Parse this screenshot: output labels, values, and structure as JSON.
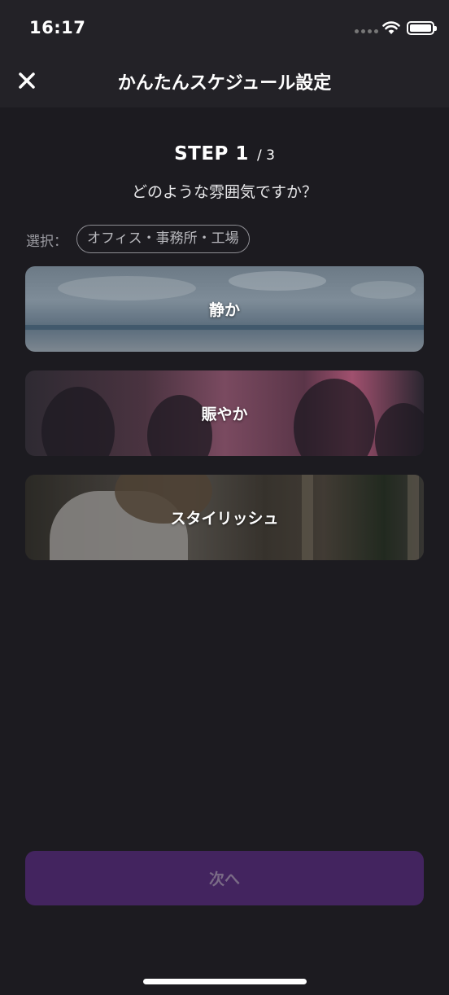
{
  "status_bar": {
    "time": "16:17"
  },
  "nav": {
    "title": "かんたんスケジュール設定",
    "close_icon": "close-icon"
  },
  "step": {
    "label": "STEP 1",
    "total": "/ 3",
    "question": "どのような雰囲気ですか？"
  },
  "selection": {
    "label": "選択：",
    "value": "オフィス・事務所・工場"
  },
  "options": [
    {
      "label": "静か"
    },
    {
      "label": "賑やか"
    },
    {
      "label": "スタイリッシュ"
    }
  ],
  "next_button": {
    "label": "次へ",
    "enabled": false
  },
  "colors": {
    "background": "#1c1b20",
    "header": "#232227",
    "next_button_bg": "#43245f",
    "next_button_text": "#7a6b86"
  }
}
